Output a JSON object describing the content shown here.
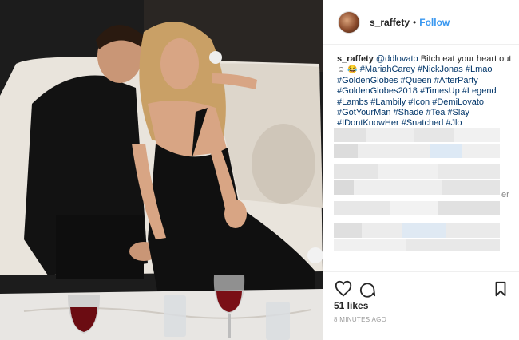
{
  "header": {
    "username": "s_raffety",
    "separator": "•",
    "follow_label": "Follow"
  },
  "caption": {
    "username": "s_raffety",
    "mention": "@ddlovato",
    "text": " Bitch eat your heart out",
    "emoji_1": "☺",
    "emoji_2": "😂",
    "hashtags": "#MariahCarey #NickJonas #Lmao #GoldenGlobes #Queen #AfterParty #GoldenGlobes2018 #TimesUp #Legend #Lambs #Lambily #Icon #DemiLovato #GotYourMan #Shade #Tea #Slay #IDontKnowHer #Snatched #Jlo"
  },
  "icons": {
    "like": "heart-icon",
    "comment": "comment-icon",
    "save": "bookmark-icon"
  },
  "stats": {
    "likes": "51 likes",
    "time": "8 MINUTES AGO"
  },
  "clipped_text": "er",
  "colors": {
    "link": "#003569",
    "follow": "#3897f0",
    "muted": "#999999"
  }
}
